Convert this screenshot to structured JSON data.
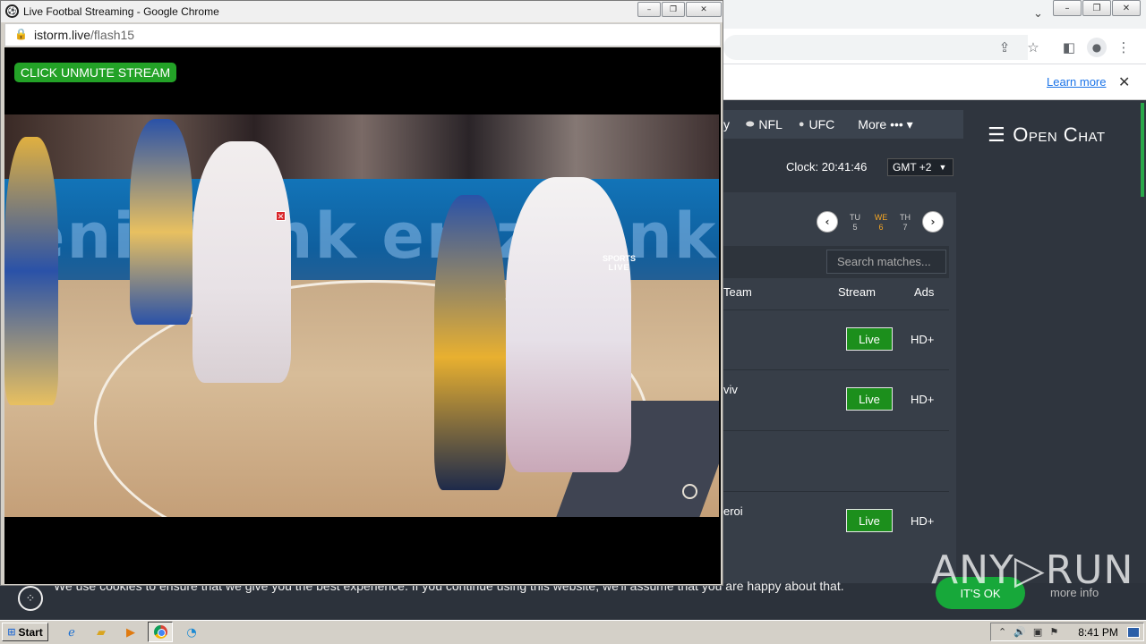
{
  "popup": {
    "title": "Live Footbal Streaming - Google Chrome",
    "url_host": "istorm.live",
    "url_path": "/flash15",
    "unmute_label": "CLICK UNMUTE STREAM",
    "score_badge_brand": "SPORTS",
    "score_badge_live": "LIVE",
    "adboard_text": "enizBank  enizBank  nizBa"
  },
  "browser": {
    "learn_more": "Learn more"
  },
  "site": {
    "nav": [
      {
        "label": "y",
        "icon": ""
      },
      {
        "label": "NFL",
        "icon": "football-icon"
      },
      {
        "label": "UFC",
        "icon": "glove-icon"
      }
    ],
    "more_label": "More ••• ▾",
    "open_chat": "Open Chat",
    "clock": "Clock: 20:41:46",
    "timezone": "GMT +2",
    "days": [
      {
        "name": "TU",
        "num": "5"
      },
      {
        "name": "WE",
        "num": "6"
      },
      {
        "name": "TH",
        "num": "7"
      }
    ],
    "search_placeholder": "Search matches...",
    "columns": {
      "team": "Team",
      "stream": "Stream",
      "ads": "Ads"
    },
    "matches": [
      {
        "team": "",
        "live": "Live",
        "ads": "HD+"
      },
      {
        "team": "viv",
        "live": "Live",
        "ads": "HD+"
      },
      {
        "team": "",
        "live": "",
        "ads": ""
      },
      {
        "team": "eroi",
        "live": "Live",
        "ads": "HD+"
      }
    ]
  },
  "cookie": {
    "text": "We use cookies to ensure that we give you the best experience. If you continue using this website, we'll assume that you are happy about that.",
    "ok": "IT'S OK",
    "more": "more info"
  },
  "watermark": "ANY▷RUN",
  "taskbar": {
    "start": "Start",
    "time": "8:41 PM"
  },
  "colors": {
    "accent_green": "#1c8f1c",
    "site_bg": "#2f353e",
    "day_active": "#f5a623"
  }
}
